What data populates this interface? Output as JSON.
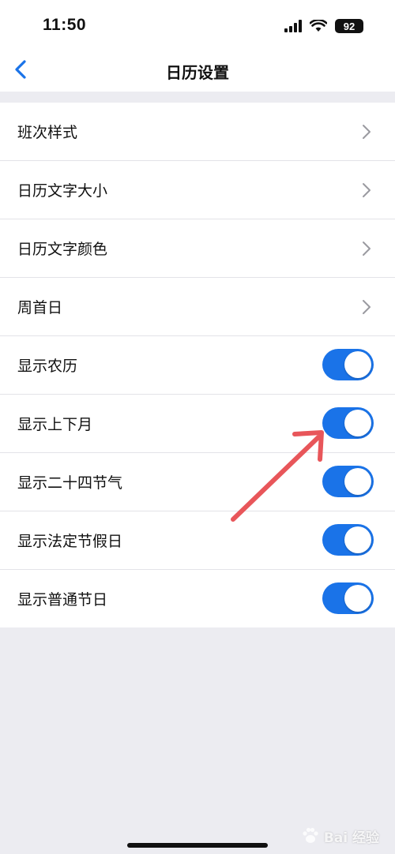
{
  "status_bar": {
    "time": "11:50",
    "battery": "92"
  },
  "nav": {
    "title": "日历设置"
  },
  "settings": [
    {
      "label": "班次样式",
      "control": "chevron"
    },
    {
      "label": "日历文字大小",
      "control": "chevron"
    },
    {
      "label": "日历文字颜色",
      "control": "chevron"
    },
    {
      "label": "周首日",
      "control": "chevron"
    },
    {
      "label": "显示农历",
      "control": "toggle",
      "on": true
    },
    {
      "label": "显示上下月",
      "control": "toggle",
      "on": true
    },
    {
      "label": "显示二十四节气",
      "control": "toggle",
      "on": true
    },
    {
      "label": "显示法定节假日",
      "control": "toggle",
      "on": true
    },
    {
      "label": "显示普通节日",
      "control": "toggle",
      "on": true
    }
  ],
  "watermark": {
    "text": "Bai 经验"
  },
  "colors": {
    "accent": "#1a73e8",
    "annotation": "#e8565a",
    "background": "#ececf1"
  }
}
